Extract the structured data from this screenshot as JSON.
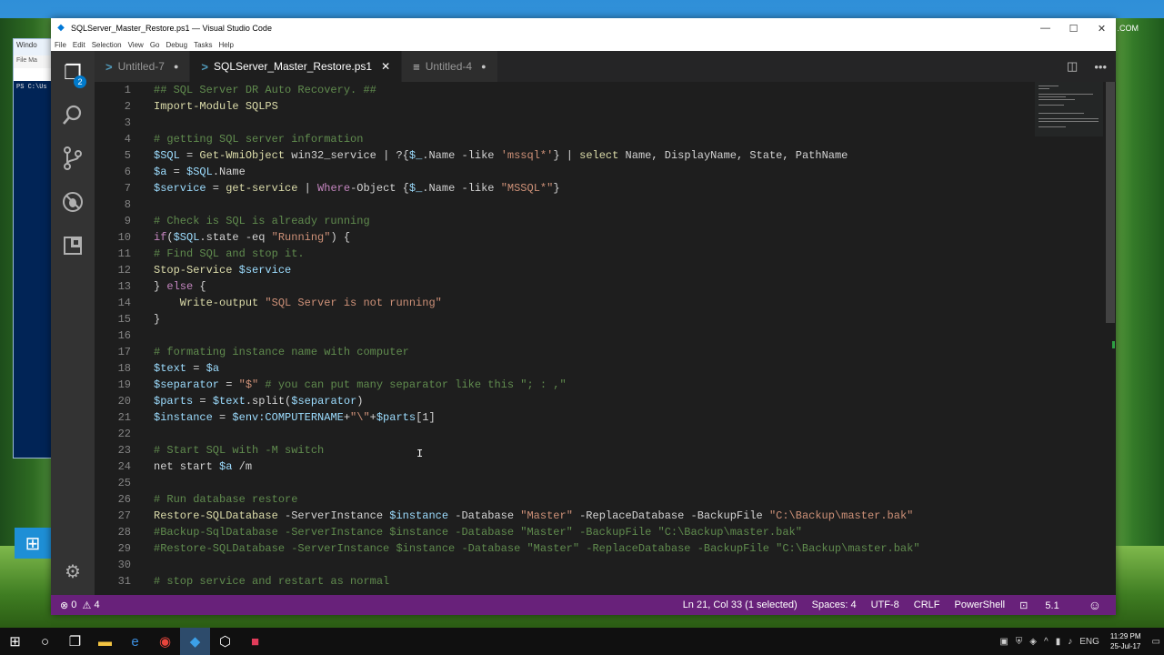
{
  "desktop": {
    "bg_window_title": "Windo",
    "bg_window_menu": "File  Ma",
    "bg_window_prompt": "PS C:\\Us",
    "corner_text": ".COM"
  },
  "window": {
    "title": "SQLServer_Master_Restore.ps1 — Visual Studio Code",
    "controls": {
      "minimize": "—",
      "maximize": "☐",
      "close": "✕"
    }
  },
  "menu": [
    "File",
    "Edit",
    "Selection",
    "View",
    "Go",
    "Debug",
    "Tasks",
    "Help"
  ],
  "activity_bar": {
    "explorer_badge": "2"
  },
  "tabs": [
    {
      "label": "Untitled-7",
      "icon": "powershell-icon",
      "glyph": ">",
      "state": "●"
    },
    {
      "label": "SQLServer_Master_Restore.ps1",
      "icon": "powershell-icon",
      "glyph": ">",
      "state": "✕"
    },
    {
      "label": "Untitled-4",
      "icon": "file-icon",
      "glyph": "≡",
      "state": "●"
    }
  ],
  "editor": {
    "lines": [
      {
        "n": "1"
      },
      {
        "n": "2"
      },
      {
        "n": "3"
      },
      {
        "n": "4"
      },
      {
        "n": "5"
      },
      {
        "n": "6"
      },
      {
        "n": "7"
      },
      {
        "n": "8"
      },
      {
        "n": "9"
      },
      {
        "n": "10"
      },
      {
        "n": "11"
      },
      {
        "n": "12"
      },
      {
        "n": "13"
      },
      {
        "n": "14"
      },
      {
        "n": "15"
      },
      {
        "n": "16"
      },
      {
        "n": "17"
      },
      {
        "n": "18"
      },
      {
        "n": "19"
      },
      {
        "n": "20"
      },
      {
        "n": "21"
      },
      {
        "n": "22"
      },
      {
        "n": "23"
      },
      {
        "n": "24"
      },
      {
        "n": "25"
      },
      {
        "n": "26"
      },
      {
        "n": "27"
      },
      {
        "n": "28"
      },
      {
        "n": "29"
      },
      {
        "n": "30"
      },
      {
        "n": "31"
      }
    ],
    "code": {
      "l1": "## SQL Server DR Auto Recovery. ##",
      "l2": "Import-Module SQLPS",
      "l4": "# getting SQL server information",
      "l5_a": "$SQL",
      "l5_b": " = ",
      "l5_c": "Get-WmiObject",
      "l5_d": " win32_service | ?{",
      "l5_e": "$_",
      "l5_f": ".Name -like ",
      "l5_g": "'mssql*'",
      "l5_h": "} | ",
      "l5_i": "select",
      "l5_j": " Name, DisplayName, State, PathName",
      "l6_a": "$a",
      "l6_b": " = ",
      "l6_c": "$SQL",
      "l6_d": ".Name",
      "l7_a": "$service",
      "l7_b": " = ",
      "l7_c": "get-service",
      "l7_d": " | ",
      "l7_e": "Where",
      "l7_f": "-Object {",
      "l7_g": "$_",
      "l7_h": ".Name -like ",
      "l7_i": "\"MSSQL*\"",
      "l7_j": "}",
      "l9": "# Check is SQL is already running",
      "l10_a": "if",
      "l10_b": "(",
      "l10_c": "$SQL",
      "l10_d": ".state -eq ",
      "l10_e": "\"Running\"",
      "l10_f": ") {",
      "l11": "# Find SQL and stop it.",
      "l12_a": "Stop-Service",
      "l12_b": " ",
      "l12_c": "$service",
      "l13_a": "} ",
      "l13_b": "else",
      "l13_c": " {",
      "l14_a": "    Write-output",
      "l14_b": " ",
      "l14_c": "\"SQL Server is not running\"",
      "l15": "}",
      "l17": "# formating instance name with computer",
      "l18_a": "$text",
      "l18_b": " = ",
      "l18_c": "$a",
      "l19_a": "$separator",
      "l19_b": " = ",
      "l19_c": "\"$\"",
      "l19_d": " # you can put many separator like this \"; : ,\"",
      "l20_a": "$parts",
      "l20_b": " = ",
      "l20_c": "$text",
      "l20_d": ".split(",
      "l20_e": "$separator",
      "l20_f": ")",
      "l21_a": "$instance",
      "l21_b": " = ",
      "l21_c": "$env:COMPUTERNAME",
      "l21_d": "+",
      "l21_e": "\"\\\"",
      "l21_f": "+",
      "l21_g": "$parts",
      "l21_h": "[1]",
      "l23": "# Start SQL with -M switch",
      "l24_a": "net start ",
      "l24_b": "$a",
      "l24_c": " /m",
      "l26": "# Run database restore",
      "l27_a": "Restore-SQLDatabase",
      "l27_b": " -ServerInstance ",
      "l27_c": "$instance",
      "l27_d": " -Database ",
      "l27_e": "\"Master\"",
      "l27_f": " -ReplaceDatabase -BackupFile ",
      "l27_g": "\"C:\\Backup\\master.bak\"",
      "l28": "#Backup-SqlDatabase -ServerInstance $instance -Database \"Master\" -BackupFile \"C:\\Backup\\master.bak\"",
      "l29": "#Restore-SQLDatabase -ServerInstance $instance -Database \"Master\" -ReplaceDatabase -BackupFile \"C:\\Backup\\master.bak\"",
      "l31": "# stop service and restart as normal"
    }
  },
  "status": {
    "errors": "0",
    "warnings": "4",
    "position": "Ln 21, Col 33 (1 selected)",
    "spaces": "Spaces: 4",
    "encoding": "UTF-8",
    "eol": "CRLF",
    "language": "PowerShell",
    "version": "5.1",
    "feedback": "☺"
  },
  "taskbar": {
    "lang": "ENG",
    "time": "11:29 PM",
    "date": "25-Jul-17"
  },
  "colors": {
    "statusbar": "#68217a",
    "comment": "#608b4e",
    "string": "#ce9178",
    "variable": "#9cdcfe",
    "keyword": "#c586c0"
  }
}
